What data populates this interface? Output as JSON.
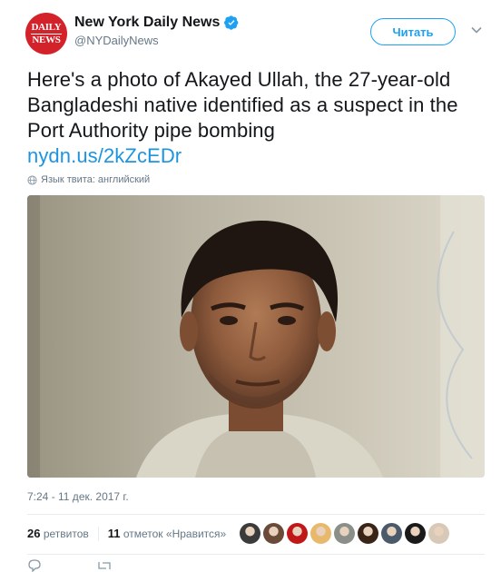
{
  "account": {
    "name": "New York Daily News",
    "handle": "@NYDailyNews",
    "avatar_line1": "DAILY",
    "avatar_line2": "NEWS"
  },
  "follow_label": "Читать",
  "tweet": {
    "text": "Here's a photo of Akayed Ullah, the 27-year-old Bangladeshi native identified as a suspect in the Port Authority pipe bombing",
    "link": "nydn.us/2kZcEDr",
    "language_note": "Язык твита: английский"
  },
  "timestamp": "7:24 - 11 дек. 2017 г.",
  "stats": {
    "retweets_count": "26",
    "retweets_label": "ретвитов",
    "likes_count": "11",
    "likes_label": "отметок «Нравится»"
  },
  "liker_avatar_colors": [
    "#3b3b3b",
    "#6a4b3a",
    "#c01818",
    "#e8b86c",
    "#8a8f8a",
    "#3a2418",
    "#4a5a6a",
    "#1a1a1a",
    "#d8c8b8"
  ],
  "colors": {
    "accent": "#1da1f2",
    "brand_red": "#d4222a"
  }
}
